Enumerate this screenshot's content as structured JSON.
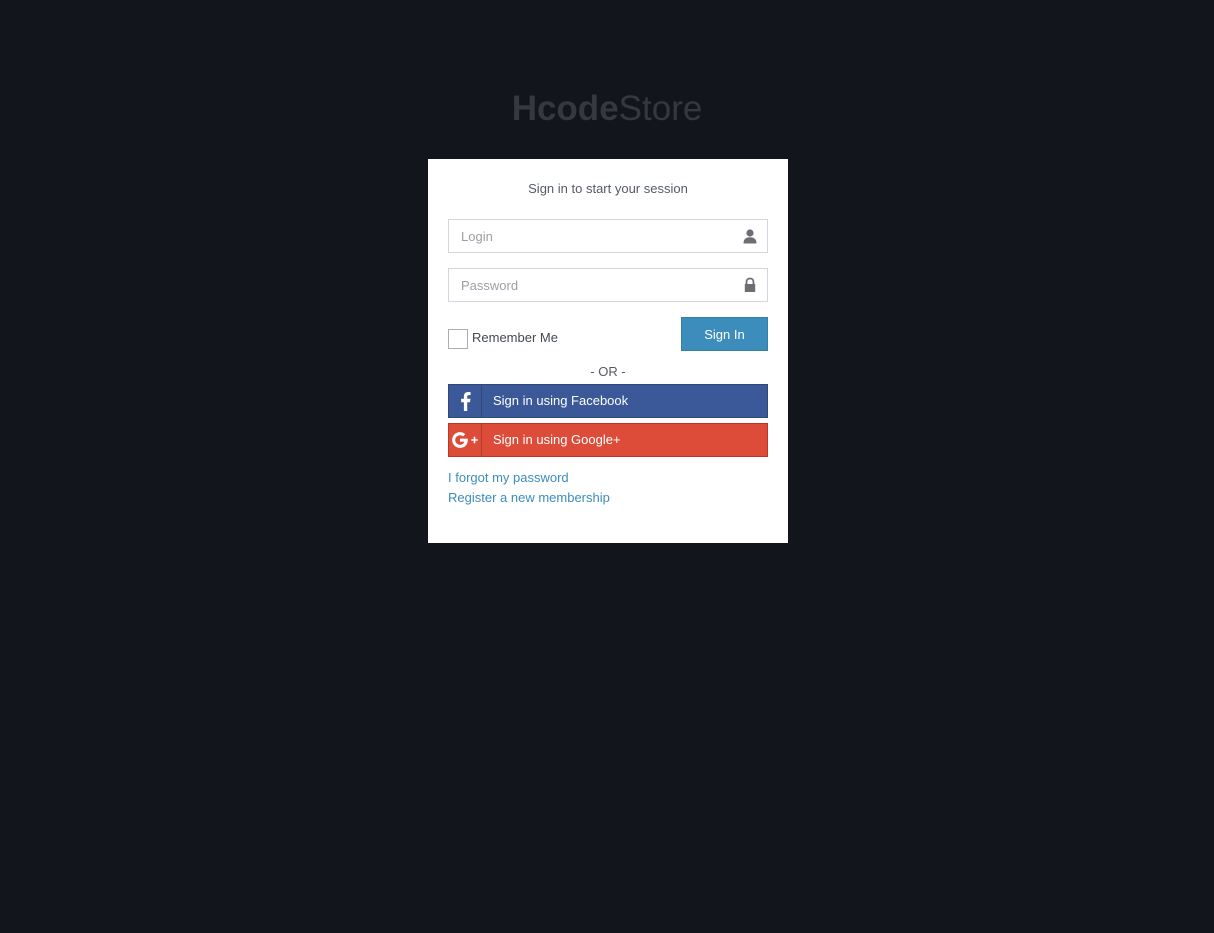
{
  "logo": {
    "bold": "Hcode",
    "light": "Store"
  },
  "login_box": {
    "message": "Sign in to start your session",
    "login_placeholder": "Login",
    "password_placeholder": "Password",
    "login_icon": "user-icon",
    "password_icon": "lock-icon",
    "remember_label": "Remember Me",
    "sign_in_label": "Sign In",
    "or_text": "- OR -",
    "facebook_label": "Sign in using Facebook",
    "google_label": "Sign in using Google+",
    "forgot_link": "I forgot my password",
    "register_link": "Register a new membership"
  },
  "colors": {
    "background": "#12151c",
    "primary": "#3c8dbc",
    "facebook": "#3b5998",
    "google": "#dd4b39"
  }
}
